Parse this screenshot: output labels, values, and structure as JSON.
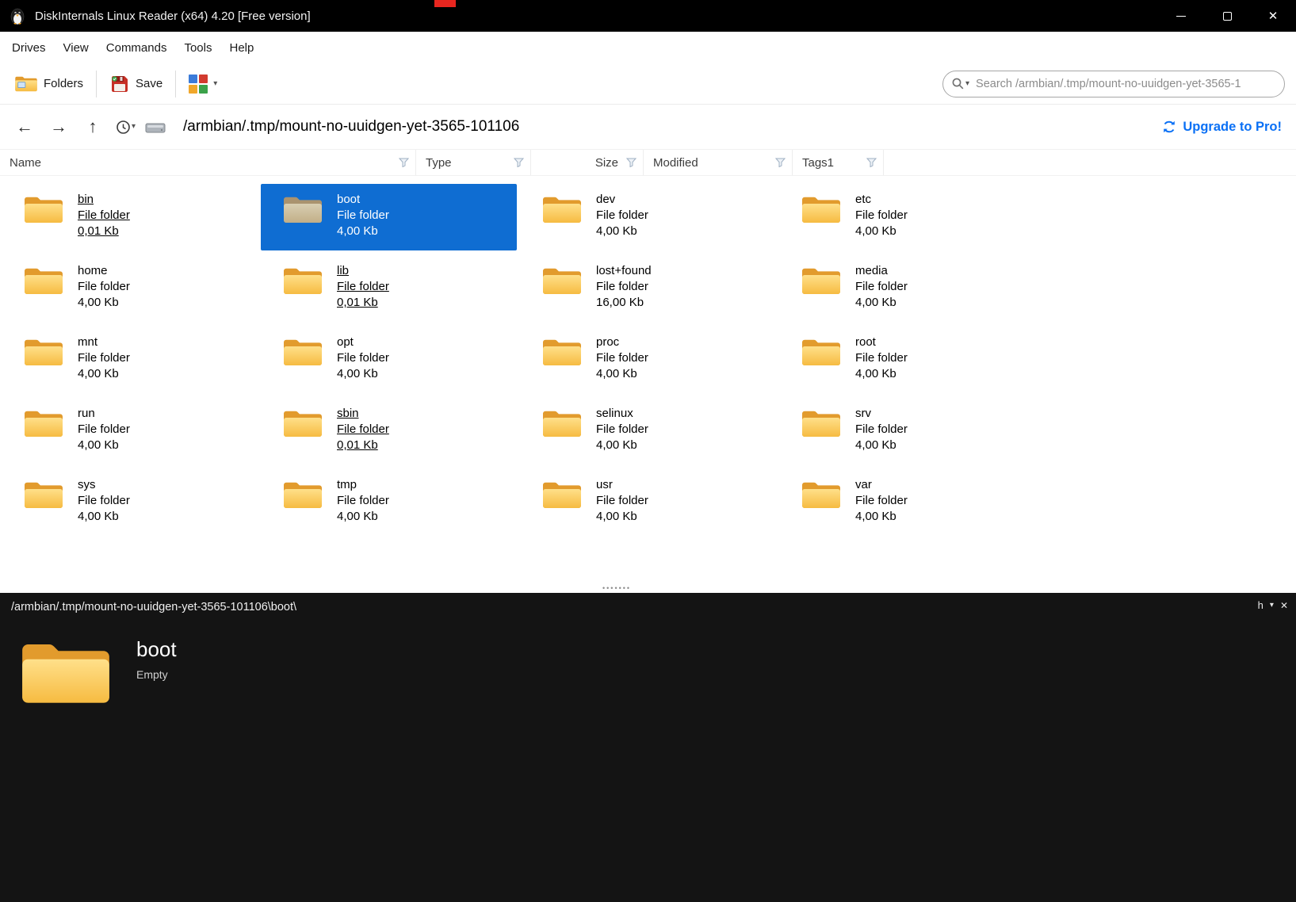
{
  "window": {
    "title": "DiskInternals Linux Reader (x64) 4.20 [Free version]"
  },
  "menu": {
    "items": [
      "Drives",
      "View",
      "Commands",
      "Tools",
      "Help"
    ]
  },
  "toolbar": {
    "folders_label": "Folders",
    "save_label": "Save"
  },
  "search": {
    "placeholder": "Search /armbian/.tmp/mount-no-uuidgen-yet-3565-1"
  },
  "navbar": {
    "path": "/armbian/.tmp/mount-no-uuidgen-yet-3565-101106",
    "upgrade_label": "Upgrade to Pro!"
  },
  "columns": [
    {
      "label": "Name"
    },
    {
      "label": "Type"
    },
    {
      "label": "Size"
    },
    {
      "label": "Modified"
    },
    {
      "label": "Tags1"
    }
  ],
  "files": {
    "type_label": "File folder",
    "items": [
      {
        "name": "bin",
        "size": "0,01 Kb",
        "link": true
      },
      {
        "name": "boot",
        "size": "4,00 Kb",
        "selected": true
      },
      {
        "name": "dev",
        "size": "4,00 Kb"
      },
      {
        "name": "etc",
        "size": "4,00 Kb"
      },
      {
        "name": "home",
        "size": "4,00 Kb"
      },
      {
        "name": "lib",
        "size": "0,01 Kb",
        "link": true
      },
      {
        "name": "lost+found",
        "size": "16,00 Kb"
      },
      {
        "name": "media",
        "size": "4,00 Kb"
      },
      {
        "name": "mnt",
        "size": "4,00 Kb"
      },
      {
        "name": "opt",
        "size": "4,00 Kb"
      },
      {
        "name": "proc",
        "size": "4,00 Kb"
      },
      {
        "name": "root",
        "size": "4,00 Kb"
      },
      {
        "name": "run",
        "size": "4,00 Kb"
      },
      {
        "name": "sbin",
        "size": "0,01 Kb",
        "link": true
      },
      {
        "name": "selinux",
        "size": "4,00 Kb"
      },
      {
        "name": "srv",
        "size": "4,00 Kb"
      },
      {
        "name": "sys",
        "size": "4,00 Kb"
      },
      {
        "name": "tmp",
        "size": "4,00 Kb"
      },
      {
        "name": "usr",
        "size": "4,00 Kb"
      },
      {
        "name": "var",
        "size": "4,00 Kb"
      }
    ]
  },
  "preview": {
    "path": "/armbian/.tmp/mount-no-uuidgen-yet-3565-101106\\boot\\",
    "name": "boot",
    "status": "Empty",
    "corner_label": "h"
  },
  "colors": {
    "selection_blue": "#0f6dd2",
    "accent_blue": "#0a70f5",
    "folder_yellow": "#f6bb41",
    "titlebar_bg": "#000000",
    "preview_bg": "#141414"
  }
}
